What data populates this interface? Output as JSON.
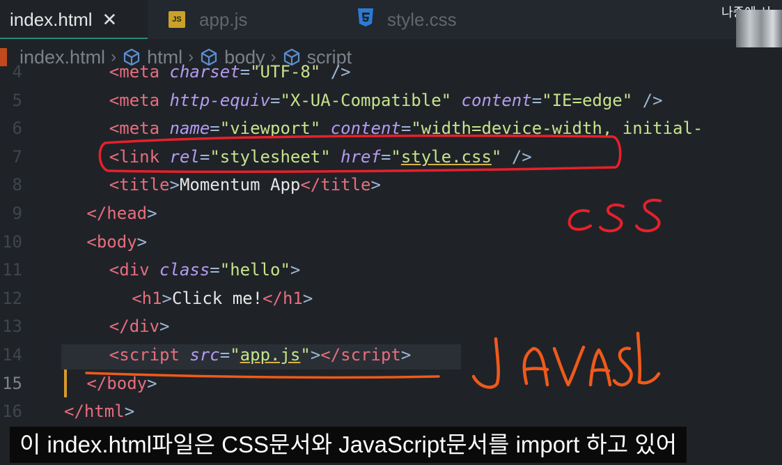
{
  "tabs": [
    {
      "label": "index.html",
      "active": true,
      "close": "✕"
    },
    {
      "label": "app.js",
      "active": false,
      "badge": "JS"
    },
    {
      "label": "style.css",
      "active": false
    }
  ],
  "breadcrumb": [
    "index.html",
    "html",
    "body",
    "script"
  ],
  "webcam_label": "나중에 시",
  "code_lines": [
    {
      "num": "4",
      "indent": 5,
      "html": "<span class='tag'>&lt;meta</span> <span class='attr'>charset</span><span class='punct'>=</span><span class='str'>\"UTF-8\"</span> <span class='punct'>/&gt;</span>"
    },
    {
      "num": "5",
      "indent": 5,
      "html": "<span class='tag'>&lt;meta</span> <span class='attr'>http-equiv</span><span class='punct'>=</span><span class='str'>\"X-UA-Compatible\"</span> <span class='attr'>content</span><span class='punct'>=</span><span class='str'>\"IE=edge\"</span> <span class='punct'>/&gt;</span>"
    },
    {
      "num": "6",
      "indent": 5,
      "html": "<span class='tag'>&lt;meta</span> <span class='attr'>name</span><span class='punct'>=</span><span class='str'>\"viewport\"</span> <span class='attr'>content</span><span class='punct'>=</span><span class='str'>\"width=device-width, initial-</span>"
    },
    {
      "num": "7",
      "indent": 5,
      "html": "<span class='tag'>&lt;link</span> <span class='attr'>rel</span><span class='punct'>=</span><span class='str'>\"stylesheet\"</span> <span class='attr'>href</span><span class='punct'>=</span><span class='str'>\"<span class='ul'>style.css</span>\"</span> <span class='punct'>/&gt;</span>"
    },
    {
      "num": "8",
      "indent": 5,
      "html": "<span class='tag'>&lt;title</span><span class='punct'>&gt;</span><span class='text'>Momentum App</span><span class='tag'>&lt;/title</span><span class='punct'>&gt;</span>"
    },
    {
      "num": "9",
      "indent": 4,
      "html": "<span class='tag'>&lt;/head</span><span class='punct'>&gt;</span>"
    },
    {
      "num": "10",
      "indent": 4,
      "html": "<span class='tag'>&lt;body</span><span class='punct'>&gt;</span>"
    },
    {
      "num": "11",
      "indent": 5,
      "html": "<span class='tag'>&lt;div</span> <span class='attr'>class</span><span class='punct'>=</span><span class='str'>\"hello\"</span><span class='punct'>&gt;</span>"
    },
    {
      "num": "12",
      "indent": 6,
      "html": "<span class='tag'>&lt;h1</span><span class='punct'>&gt;</span><span class='text'>Click me!</span><span class='tag'>&lt;/h1</span><span class='punct'>&gt;</span>"
    },
    {
      "num": "13",
      "indent": 5,
      "html": "<span class='tag'>&lt;/div</span><span class='punct'>&gt;</span>"
    },
    {
      "num": "14",
      "indent": 5,
      "html": "<span class='tag'>&lt;script</span> <span class='attr'>src</span><span class='punct'>=</span><span class='str'>\"<span class='ul'>app.js</span>\"</span><span class='punct'>&gt;</span><span class='tag'>&lt;/script</span><span class='punct'>&gt;</span>"
    },
    {
      "num": "15",
      "indent": 4,
      "current": true,
      "html": "<span class='tag'>&lt;/body</span><span class='punct'>&gt;</span>"
    },
    {
      "num": "16",
      "indent": 3,
      "html": "<span class='tag'>&lt;/html</span><span class='punct'>&gt;</span>"
    }
  ],
  "subtitle": "이 index.html파일은 CSS문서와 JavaScript문서를 import 하고 있어",
  "colors": {
    "annotation_red": "#e8202a",
    "annotation_orange": "#f05a1a"
  }
}
